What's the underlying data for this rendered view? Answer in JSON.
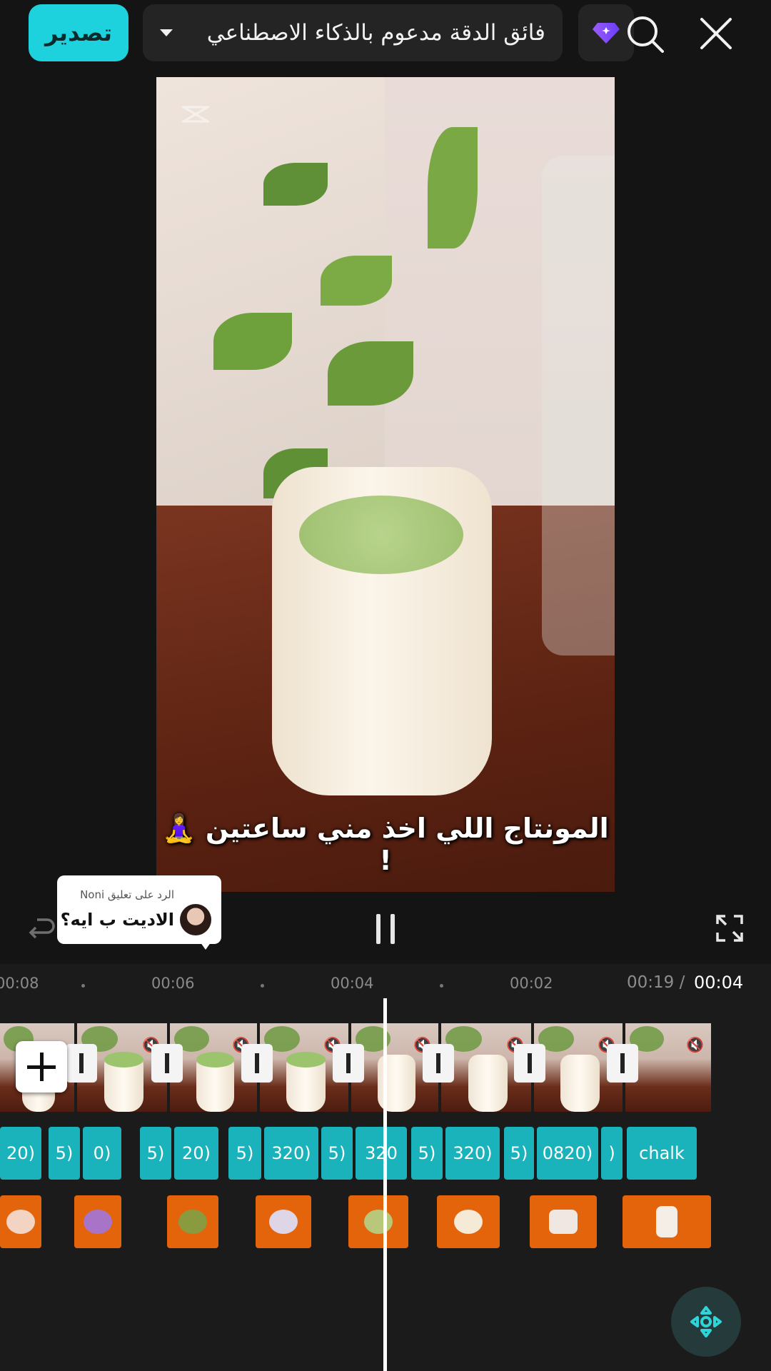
{
  "topbar": {
    "export_label": "تصدير",
    "resolution_label": "فائق الدقة مدعوم بالذكاء الاصطناعي",
    "accent_color": "#1dd2dc"
  },
  "preview": {
    "caption": "المونتاج اللي اخذ مني ساعتين 🧘‍♀️ !"
  },
  "reply_sticker": {
    "subtitle": "الرد على تعليق Noni",
    "text": "الاديت ب ايه؟"
  },
  "timeline": {
    "ruler": [
      "00:08",
      "00:06",
      "00:04",
      "00:02"
    ],
    "current_time": "00:04",
    "total_time": "00:19",
    "separator": "/",
    "text_clips": [
      "20)",
      "5)",
      "0)",
      "5)",
      "20)",
      "5)",
      "320)",
      "5)",
      "320",
      "5)",
      "320)",
      "5)",
      "0820)",
      ")",
      "chalk"
    ],
    "sticker_color": "#e4640c",
    "text_clip_color": "#1ab3bb"
  },
  "icons": {
    "close": "close-icon",
    "search": "search-icon",
    "pro": "diamond-icon",
    "undo": "undo-icon",
    "pause": "pause-icon",
    "fullscreen": "fullscreen-icon",
    "keyframe": "keyframe-icon"
  }
}
